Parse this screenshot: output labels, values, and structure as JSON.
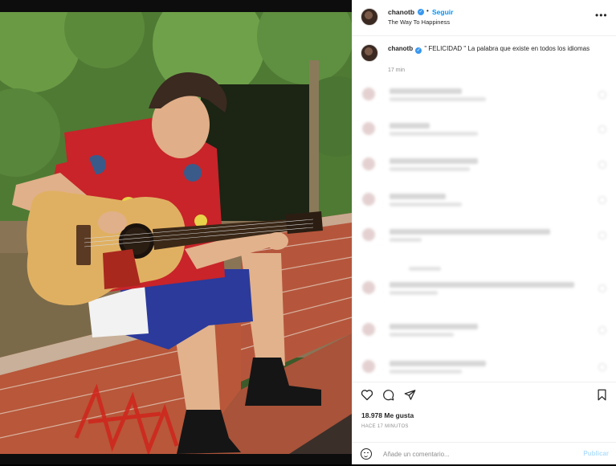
{
  "post": {
    "author": "chanotb",
    "follow_label": "Seguir",
    "separator": "•",
    "subtitle": "The Way To Happiness",
    "more_label": "•••",
    "caption_author": "chanotb",
    "caption_text": " \" FELICIDAD \" La palabra que existe en todos los idiomas",
    "time_label": "17 min",
    "likes_label": "18.978 Me gusta",
    "posted_ago": "HACE 17 MINUTOS",
    "comment_placeholder": "Añade un comentario...",
    "publish_label": "Publicar"
  },
  "icons": {
    "verified": "verified-badge-icon",
    "heart": "heart-icon",
    "comment": "comment-bubble-icon",
    "share": "paper-plane-icon",
    "save": "bookmark-icon",
    "emoji": "smiley-icon"
  },
  "colors": {
    "link_blue": "#0095f6",
    "verified_blue": "#3897f0",
    "text": "#262626",
    "muted": "#8e8e8e"
  }
}
